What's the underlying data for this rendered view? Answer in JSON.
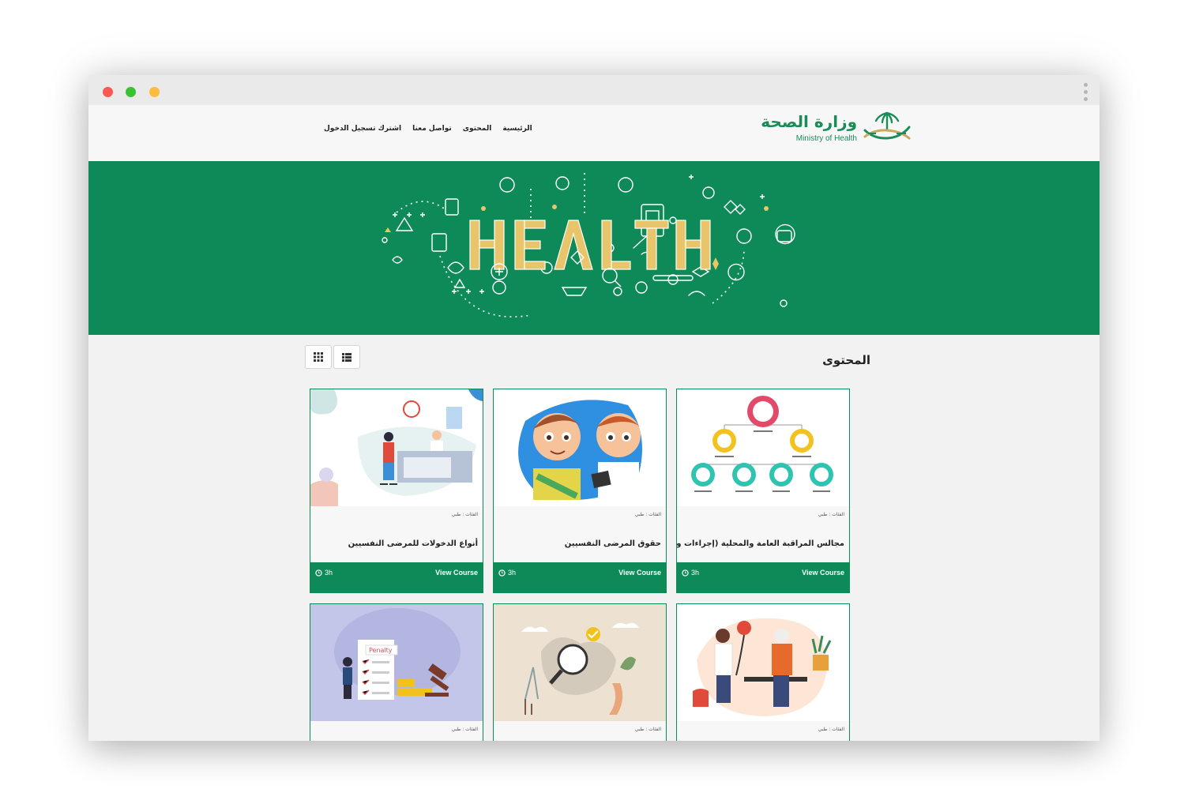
{
  "nav": {
    "links": [
      "الرئيسية",
      "المحتوى",
      "تواصل معنا",
      "اشترك تسجيل الدخول"
    ]
  },
  "logo": {
    "arabic": "وزارة الصحة",
    "english": "Ministry of Health"
  },
  "hero": {
    "letters": [
      "H",
      "E",
      "A",
      "L",
      "T",
      "H"
    ],
    "colors": {
      "background": "#0d8a57",
      "accent": "#e8c46a"
    }
  },
  "content": {
    "title": "المحتوى",
    "view_icons": [
      "grid-icon",
      "list-icon"
    ]
  },
  "cards": [
    {
      "category": "الفئات : طبي",
      "title": "مجالس المراقبة العامة والمحلية (إجراءات وآلية عمل)",
      "view_label": "View Course",
      "duration": "3h"
    },
    {
      "category": "الفئات : طبي",
      "title": "حقوق المرضى النفسيين",
      "view_label": "View Course",
      "duration": "3h"
    },
    {
      "category": "الفئات : طبي",
      "title": "أنواع الدخولات للمرضى النفسيين",
      "view_label": "View Course",
      "duration": "3h"
    },
    {
      "category": "الفئات : طبي",
      "penalty_label": ""
    },
    {
      "category": "الفئات : طبي"
    },
    {
      "category": "الفئات : طبي"
    }
  ],
  "illustration_text": {
    "penalty": "Penalty"
  },
  "colors": {
    "brand_green": "#0d8a57",
    "page_bg": "#f2f2f2"
  }
}
